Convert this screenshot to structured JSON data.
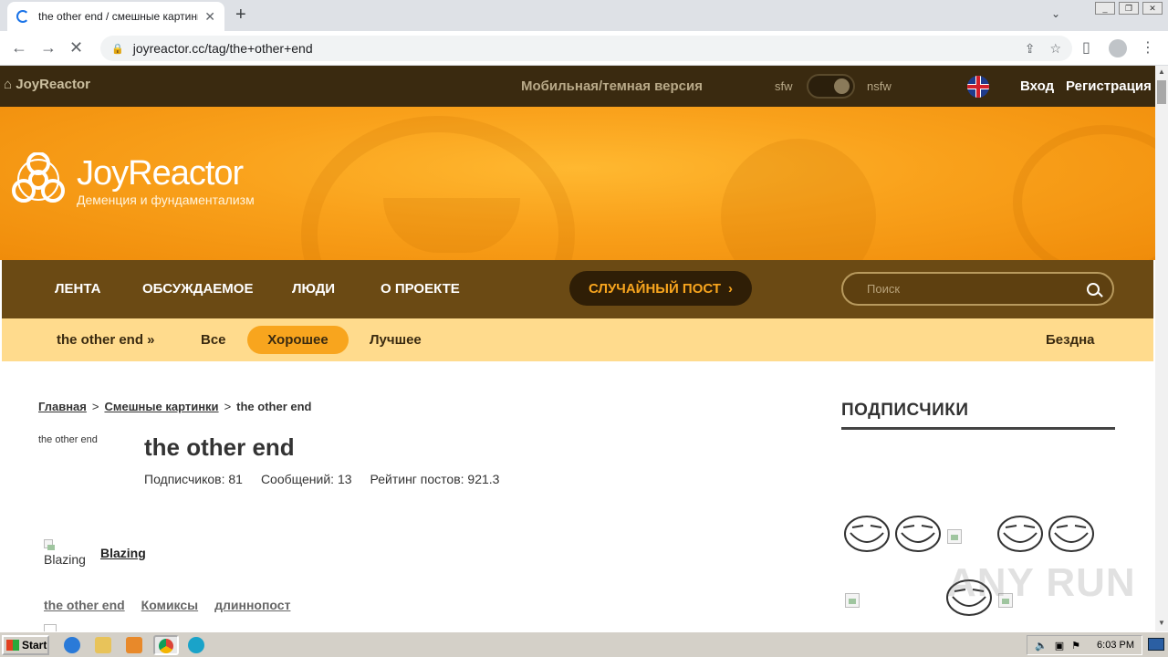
{
  "browser": {
    "tab_title": "the other end / смешные картинки и другие приколы",
    "url": "joyreactor.cc/tag/the+other+end"
  },
  "site": {
    "home_label": "JoyReactor",
    "mobile_label": "Мобильная/темная версия",
    "sfw_label": "sfw",
    "nsfw_label": "nsfw",
    "login_label": "Вход",
    "register_label": "Регистрация",
    "logo_name": "JoyReactor",
    "logo_tagline": "Деменция и фундаментализм"
  },
  "mainnav": {
    "items": [
      "ЛЕНТА",
      "ОБСУЖДАЕМОЕ",
      "ЛЮДИ",
      "О ПРОЕКТЕ"
    ],
    "random_label": "СЛУЧАЙНЫЙ ПОСТ",
    "search_placeholder": "Поиск"
  },
  "subnav": {
    "tag_label": "the other end »",
    "all_label": "Все",
    "good_label": "Хорошее",
    "best_label": "Лучшее",
    "abyss_label": "Бездна"
  },
  "content": {
    "breadcrumbs": [
      "Главная",
      "Смешные картинки",
      "the other end"
    ],
    "breadcrumb_sep": ">",
    "tag_image_alt": "the other end",
    "tag_title": "the other end",
    "stats": {
      "subscribers": "Подписчиков: 81",
      "messages": "Сообщений: 13",
      "rating": "Рейтинг постов: 921.3"
    },
    "post_author_img_alt": "Blazing",
    "post_author": "Blazing",
    "post_tags": [
      "the other end",
      "Комиксы",
      "длиннопост"
    ]
  },
  "sidebar": {
    "title": "ПОДПИСЧИКИ"
  },
  "watermark": "ANY RUN",
  "taskbar": {
    "start_label": "Start",
    "clock": "6:03 PM"
  },
  "colors": {
    "topbar": "#3a2a10",
    "hero_orange": "#f9a11b",
    "mainnav": "#6b4a14",
    "subnav": "#ffdb8d",
    "accent": "#f8a51e"
  }
}
